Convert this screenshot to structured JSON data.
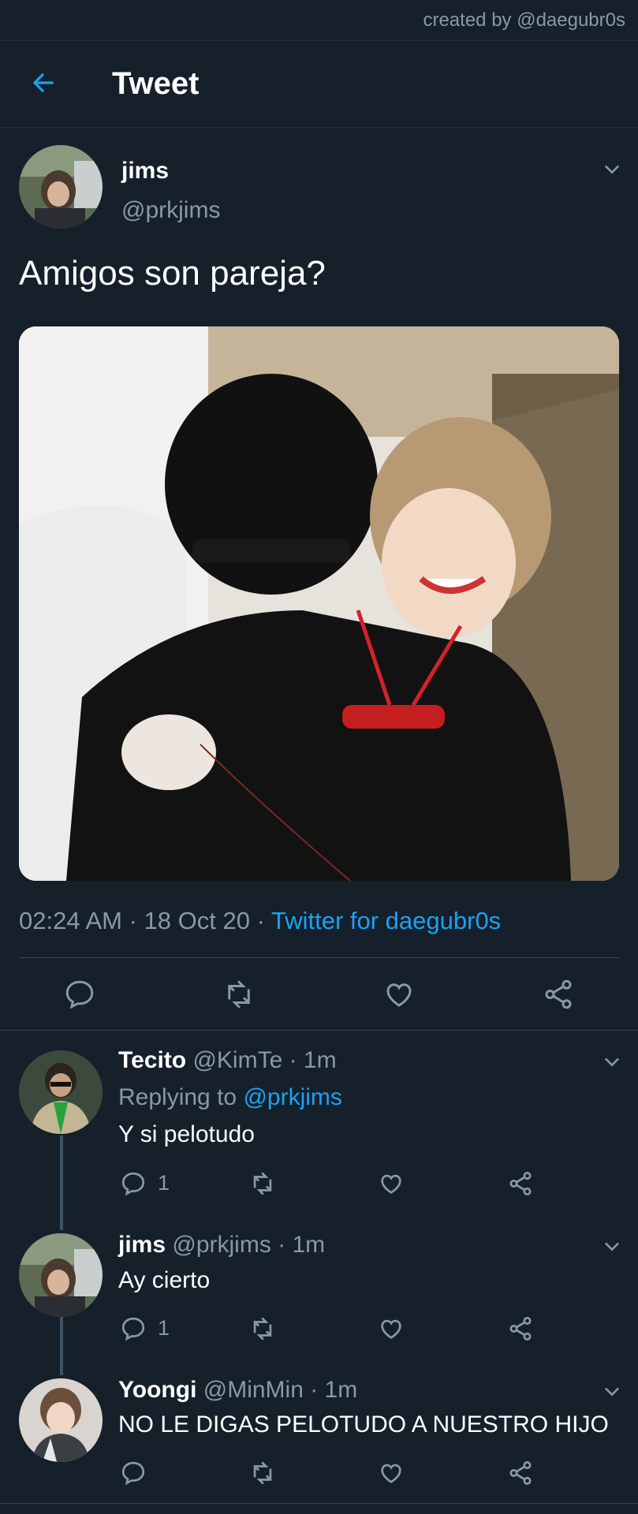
{
  "credit": "created by @daegubr0s",
  "header": {
    "title": "Tweet"
  },
  "tweet": {
    "name": "jims",
    "handle": "@prkjims",
    "text": "Amigos son pareja?",
    "time": "02:24 AM",
    "date": "18 Oct 20",
    "source": "Twitter for daegubr0s"
  },
  "replies": [
    {
      "name": "Tecito",
      "meta": "@KimTe · 1m",
      "replying_label": "Replying to",
      "replying_to": "@prkjims",
      "text": "Y si pelotudo",
      "reply_count": "1"
    },
    {
      "name": "jims",
      "meta": "@prkjims · 1m",
      "text": "Ay cierto",
      "reply_count": "1"
    },
    {
      "name": "Yoongi",
      "meta": "@MinMin · 1m",
      "text": "NO LE DIGAS PELOTUDO A NUESTRO HIJO",
      "reply_count": ""
    }
  ],
  "colors": {
    "background": "#15202b",
    "accent": "#1da1f2",
    "secondary_text": "#8899a6"
  },
  "icons": [
    "back-arrow-icon",
    "chevron-down-icon",
    "reply-icon",
    "retweet-icon",
    "like-icon",
    "share-icon"
  ]
}
